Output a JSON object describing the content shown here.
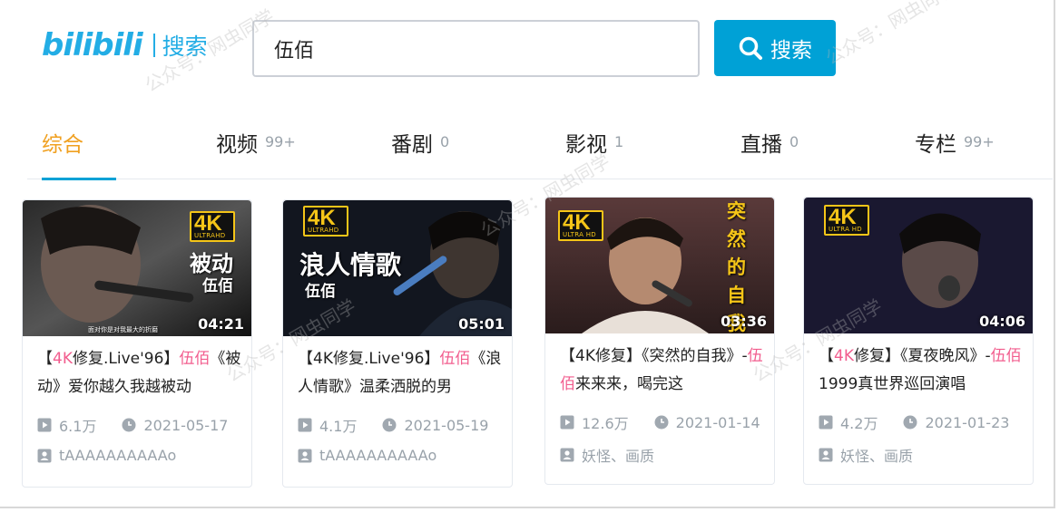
{
  "header": {
    "logo_text": "bilibili",
    "logo_sub": "搜索",
    "search_value": "伍佰",
    "search_button": "搜索"
  },
  "tabs": [
    {
      "label": "综合",
      "count": ""
    },
    {
      "label": "视频",
      "count": "99+"
    },
    {
      "label": "番剧",
      "count": "0"
    },
    {
      "label": "影视",
      "count": "1"
    },
    {
      "label": "直播",
      "count": "0"
    },
    {
      "label": "专栏",
      "count": "99+"
    }
  ],
  "cards": [
    {
      "thumb_text": "被动",
      "thumb_artist": "伍佰",
      "thumb_caption": "面对你是对我最大的折磨",
      "badge": "4K",
      "badge_sub": "ULTRAHD",
      "duration": "04:21",
      "title_pre": "【",
      "title_hl1": "4K",
      "title_mid": "修复.Live'96】",
      "title_hl2": "伍佰",
      "title_post": "《被动》爱你越久我越被动",
      "plays": "6.1万",
      "date": "2021-05-17",
      "uploader": "tAAAAAAAAAAo"
    },
    {
      "thumb_text": "浪人情歌",
      "thumb_artist": "伍佰",
      "badge": "4K",
      "badge_sub": "ULTRAHD",
      "duration": "05:01",
      "title_pre": "【4K修复.Live'96】",
      "title_hl2": "伍佰",
      "title_post": "《浪人情歌》温柔洒脱的男",
      "plays": "4.1万",
      "date": "2021-05-19",
      "uploader": "tAAAAAAAAAAo"
    },
    {
      "thumb_text": "突然的自我",
      "badge": "4K",
      "badge_sub": "ULTRA HD",
      "duration": "03:36",
      "title_pre": "【4K修复】《突然的自我》-",
      "title_hl2": "伍佰",
      "title_post": "来来来，喝完这",
      "plays": "12.6万",
      "date": "2021-01-14",
      "uploader": "妖怪、画质"
    },
    {
      "badge": "4K",
      "badge_sub": "ULTRA HD",
      "duration": "04:06",
      "title_pre": "【",
      "title_hl1": "4K",
      "title_mid": "修复】《夏夜晚风》-",
      "title_hl2": "伍佰",
      "title_post": "1999真世界巡回演唱",
      "plays": "4.2万",
      "date": "2021-01-23",
      "uploader": "妖怪、画质"
    }
  ],
  "watermark": "公众号：网虫同学",
  "colors": {
    "brand": "#00a1d6",
    "highlight": "#f25d8e",
    "active_tab": "#f0a020",
    "badge": "#f5c518"
  }
}
